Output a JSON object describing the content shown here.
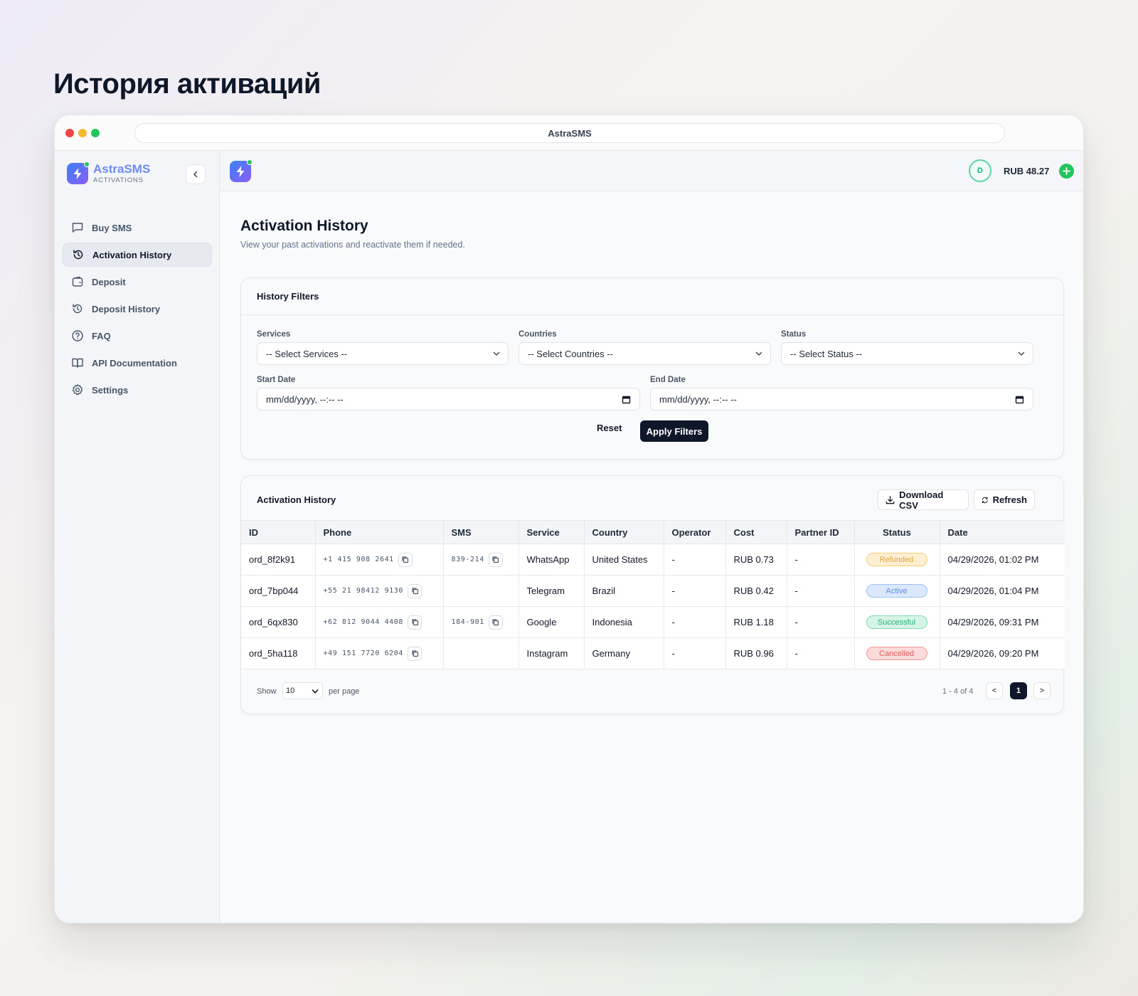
{
  "page_heading": "История активаций",
  "browser": {
    "url_title": "AstraSMS"
  },
  "brand": {
    "name": "AstraSMS",
    "subtitle": "ACTIVATIONS"
  },
  "sidebar": {
    "items": [
      {
        "label": "Buy SMS",
        "icon": "message-square-icon",
        "active": false
      },
      {
        "label": "Activation History",
        "icon": "history-icon",
        "active": true
      },
      {
        "label": "Deposit",
        "icon": "wallet-icon",
        "active": false
      },
      {
        "label": "Deposit History",
        "icon": "history-icon",
        "active": false
      },
      {
        "label": "FAQ",
        "icon": "help-circle-icon",
        "active": false
      },
      {
        "label": "API Documentation",
        "icon": "book-open-icon",
        "active": false
      },
      {
        "label": "Settings",
        "icon": "gear-icon",
        "active": false
      }
    ]
  },
  "topbar": {
    "avatar_initial": "D",
    "balance": "RUB 48.27"
  },
  "main": {
    "title": "Activation History",
    "subtitle": "View your past activations and reactivate them if needed."
  },
  "filters": {
    "title": "History Filters",
    "services_label": "Services",
    "services_value": "-- Select Services --",
    "countries_label": "Countries",
    "countries_value": "-- Select Countries --",
    "status_label": "Status",
    "status_value": "-- Select Status --",
    "start_label": "Start Date",
    "start_value": "mm/dd/yyyy, --:-- --",
    "end_label": "End Date",
    "end_value": "mm/dd/yyyy, --:-- --",
    "reset_label": "Reset",
    "apply_label": "Apply Filters"
  },
  "history_table": {
    "title": "Activation History",
    "download_label": "Download CSV",
    "refresh_label": "Refresh",
    "columns": [
      "ID",
      "Phone",
      "SMS",
      "Service",
      "Country",
      "Operator",
      "Cost",
      "Partner ID",
      "Status",
      "Date"
    ],
    "rows": [
      {
        "id": "ord_8f2k91",
        "phone": "+1 415 908 2641",
        "sms": "839-214",
        "service": "WhatsApp",
        "country": "United States",
        "operator": "-",
        "cost": "RUB 0.73",
        "partner": "-",
        "status": "Refunded",
        "date": "04/29/2026, 01:02 PM"
      },
      {
        "id": "ord_7bp044",
        "phone": "+55 21 98412 9130",
        "sms": "",
        "service": "Telegram",
        "country": "Brazil",
        "operator": "-",
        "cost": "RUB 0.42",
        "partner": "-",
        "status": "Active",
        "date": "04/29/2026, 01:04 PM"
      },
      {
        "id": "ord_6qx830",
        "phone": "+62 812 9044 4408",
        "sms": "184-901",
        "service": "Google",
        "country": "Indonesia",
        "operator": "-",
        "cost": "RUB 1.18",
        "partner": "-",
        "status": "Successful",
        "date": "04/29/2026, 09:31 PM"
      },
      {
        "id": "ord_5ha118",
        "phone": "+49 151 7720 6204",
        "sms": "",
        "service": "Instagram",
        "country": "Germany",
        "operator": "-",
        "cost": "RUB 0.96",
        "partner": "-",
        "status": "Cancelled",
        "date": "04/29/2026, 09:20 PM"
      }
    ],
    "status_colors": {
      "Refunded": {
        "bg": "#fdf0d2",
        "border": "#f6cf73",
        "text": "#e0a53a"
      },
      "Active": {
        "bg": "#dbe7fb",
        "border": "#9ec0f3",
        "text": "#5b8fe0"
      },
      "Successful": {
        "bg": "#d5f4e6",
        "border": "#7fdcb5",
        "text": "#28b07a"
      },
      "Cancelled": {
        "bg": "#fbdada",
        "border": "#f09a9a",
        "text": "#de5b5b"
      }
    }
  },
  "pagination": {
    "show_label": "Show",
    "per_page_value": "10",
    "per_page_label": "per page",
    "range_label": "1 - 4 of 4",
    "prev_label": "<",
    "current_page": "1",
    "next_label": ">"
  },
  "colors": {
    "accent_dark": "#0f172a",
    "brand_blue": "#6d8cf5",
    "success_green": "#22c55e"
  }
}
